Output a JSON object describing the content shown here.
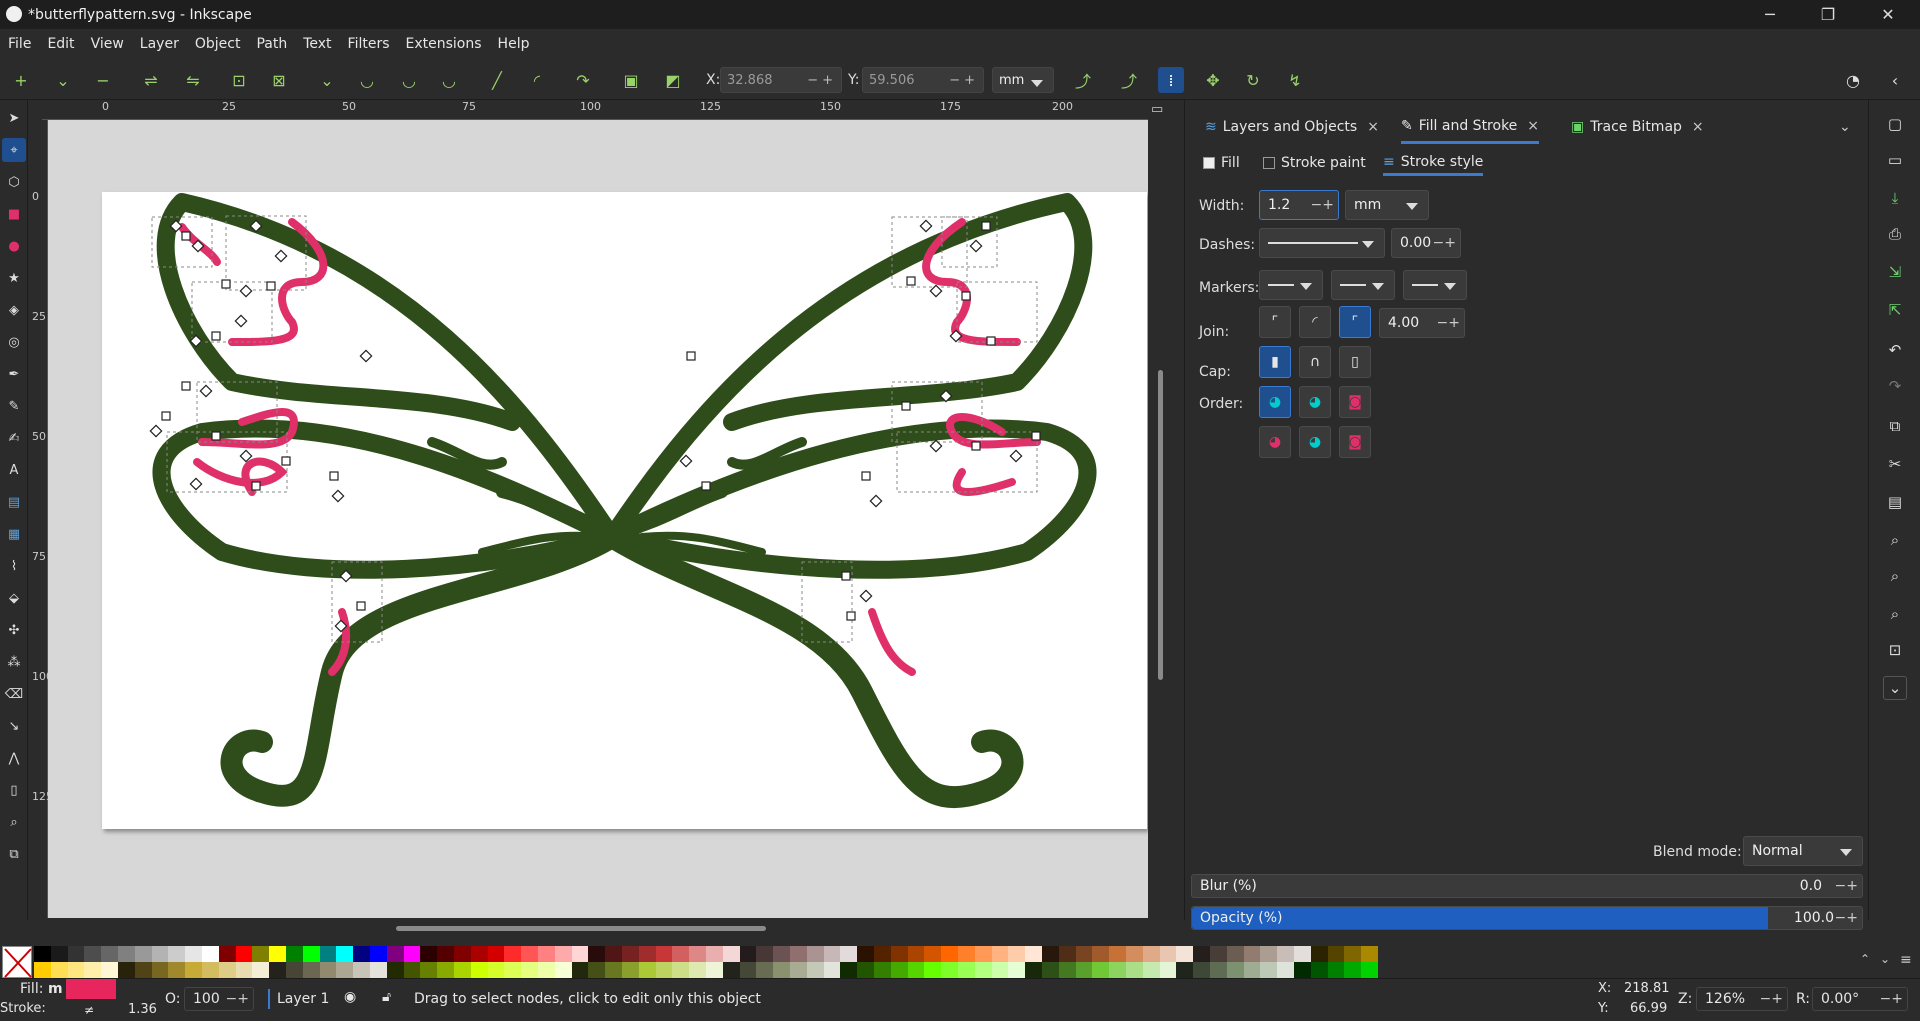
{
  "titlebar": {
    "title": "*butterflypattern.svg - Inkscape",
    "minimize": "─",
    "maximize": "❐",
    "close": "✕"
  },
  "menu": [
    "File",
    "Edit",
    "View",
    "Layer",
    "Object",
    "Path",
    "Text",
    "Filters",
    "Extensions",
    "Help"
  ],
  "toolctrl": {
    "x_label": "X:",
    "x_value": "32.868",
    "y_label": "Y:",
    "y_value": "59.506",
    "unit": "mm"
  },
  "rulers": {
    "h_ticks": [
      "0",
      "25",
      "50",
      "75",
      "100",
      "125",
      "150",
      "175",
      "200"
    ],
    "v_ticks": [
      "0",
      "25",
      "50",
      "75",
      "100",
      "125"
    ]
  },
  "dock": {
    "tabs": [
      {
        "label": "Layers and Objects",
        "close": "×"
      },
      {
        "label": "Fill and Stroke",
        "close": "×"
      },
      {
        "label": "Trace Bitmap",
        "close": "×"
      }
    ],
    "subtabs": [
      "Fill",
      "Stroke paint",
      "Stroke style"
    ],
    "width_label": "Width:",
    "width_value": "1.2",
    "width_unit": "mm",
    "dashes_label": "Dashes:",
    "dash_offset": "0.00",
    "markers_label": "Markers:",
    "join_label": "Join:",
    "miter_value": "4.00",
    "cap_label": "Cap:",
    "order_label": "Order:",
    "blend_label": "Blend mode:",
    "blend_value": "Normal",
    "blur_label": "Blur (%)",
    "blur_value": "0.0",
    "opacity_label": "Opacity (%)",
    "opacity_value": "100.0"
  },
  "status": {
    "fill_label": "Fill:",
    "fill_value": "m",
    "fill_color": "#e8265e",
    "stroke_label": "Stroke:",
    "stroke_value": "≠",
    "stroke_width": "1.36",
    "opacity_label": "O:",
    "opacity_value": "100",
    "layer": "Layer 1",
    "message": "Drag to select nodes, click to edit only this object",
    "cursor_x_label": "X:",
    "cursor_x": "218.81",
    "cursor_y_label": "Y:",
    "cursor_y": "66.99",
    "zoom_label": "Z:",
    "zoom": "126%",
    "rotation_label": "R:",
    "rotation": "0.00°"
  },
  "colors": {
    "accent": "#1f4f8f",
    "butterfly": "#2e4d1a",
    "pattern": "#e0306a"
  }
}
